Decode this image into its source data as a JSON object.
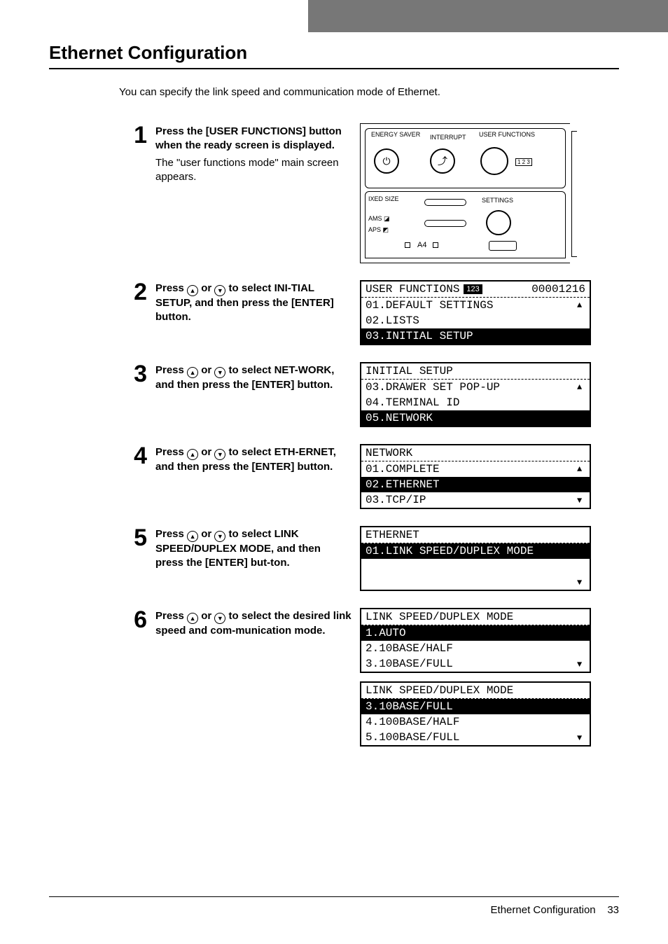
{
  "page": {
    "title": "Ethernet Configuration",
    "intro": "You can specify the link speed and communication mode of Ethernet.",
    "footer_label": "Ethernet Configuration",
    "footer_page": "33"
  },
  "panel": {
    "energy_saver": "ENERGY\nSAVER",
    "interrupt": "INTERRUPT",
    "user_functions": "USER\nFUNCTIONS",
    "settings": "SETTINGS",
    "ixed_size": "IXED\nSIZE",
    "ams": "AMS",
    "aps": "APS",
    "tag123": "1 2 3",
    "paper": "A4"
  },
  "steps": [
    {
      "num": "1",
      "bold": "Press the [USER FUNCTIONS] button when the ready screen is displayed.",
      "body": "The \"user functions mode\" main screen appears.",
      "panel": true
    },
    {
      "num": "2",
      "bold_parts": [
        "Press ",
        " or ",
        " to select INI-TIAL SETUP, and then press the [ENTER] button."
      ],
      "lcds": [
        {
          "header": "USER FUNCTIONS",
          "header_tag": "123",
          "header_right": "00001216",
          "rows": [
            {
              "t": "01.DEFAULT SETTINGS",
              "sel": false
            },
            {
              "t": "02.LISTS",
              "sel": false
            },
            {
              "t": "03.INITIAL SETUP",
              "sel": true
            }
          ]
        }
      ]
    },
    {
      "num": "3",
      "bold_parts": [
        "Press ",
        " or ",
        " to select NET-WORK, and then press the [ENTER] button."
      ],
      "lcds": [
        {
          "header": "INITIAL SETUP",
          "rows": [
            {
              "t": "03.DRAWER SET POP-UP",
              "sel": false
            },
            {
              "t": "04.TERMINAL ID",
              "sel": false
            },
            {
              "t": "05.NETWORK",
              "sel": true
            }
          ]
        }
      ]
    },
    {
      "num": "4",
      "bold_parts": [
        "Press ",
        " or ",
        " to select ETH-ERNET, and then press the [ENTER] button."
      ],
      "lcds": [
        {
          "header": "NETWORK",
          "rows": [
            {
              "t": "01.COMPLETE",
              "sel": false
            },
            {
              "t": "02.ETHERNET",
              "sel": true
            },
            {
              "t": "03.TCP/IP",
              "sel": false
            }
          ]
        }
      ]
    },
    {
      "num": "5",
      "bold_parts": [
        "Press ",
        " or ",
        " to select LINK SPEED/DUPLEX MODE, and then press the [ENTER] but-ton."
      ],
      "lcds": [
        {
          "header": "ETHERNET",
          "rows": [
            {
              "t": "01.LINK SPEED/DUPLEX MODE",
              "sel": true
            },
            {
              "t": " ",
              "sel": false
            },
            {
              "t": " ",
              "sel": false
            }
          ]
        }
      ]
    },
    {
      "num": "6",
      "bold_parts": [
        "Press ",
        " or ",
        " to select the desired link speed and com-munication mode."
      ],
      "lcds": [
        {
          "header": "LINK SPEED/DUPLEX MODE",
          "rows": [
            {
              "t": "1.AUTO",
              "sel": true
            },
            {
              "t": "2.10BASE/HALF",
              "sel": false
            },
            {
              "t": "3.10BASE/FULL",
              "sel": false
            }
          ]
        },
        {
          "header": "LINK SPEED/DUPLEX MODE",
          "rows": [
            {
              "t": "3.10BASE/FULL",
              "sel": true
            },
            {
              "t": "4.100BASE/HALF",
              "sel": false
            },
            {
              "t": "5.100BASE/FULL",
              "sel": false
            }
          ]
        }
      ]
    }
  ]
}
